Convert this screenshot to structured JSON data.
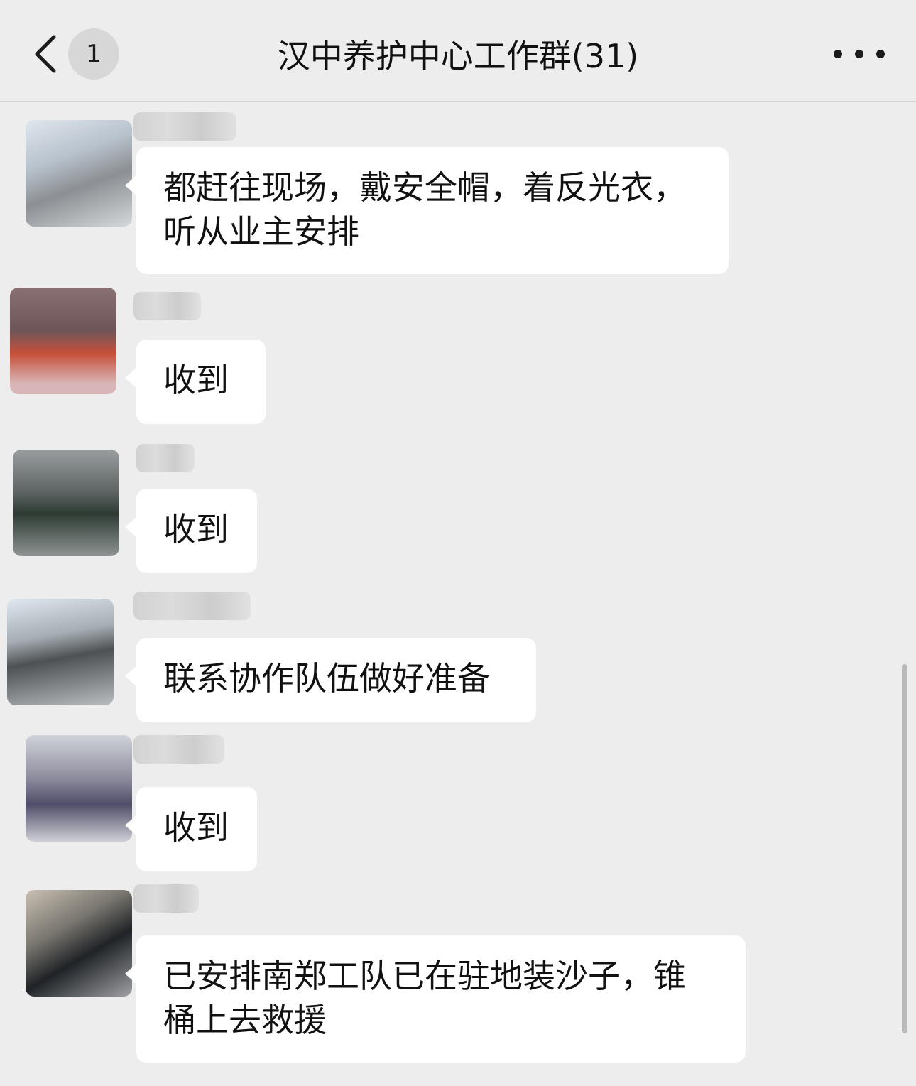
{
  "header": {
    "back_icon": "chevron-left-icon",
    "unread_count": "1",
    "title": "汉中养护中心工作群(31)",
    "more_icon": "more-horizontal-icon"
  },
  "messages": [
    {
      "text_lines": [
        "都赶往现场，戴安全帽，着反光衣，",
        "听从业主安排"
      ]
    },
    {
      "text_lines": [
        "收到"
      ]
    },
    {
      "text_lines": [
        "收到"
      ]
    },
    {
      "text_lines": [
        "联系协作队伍做好准备"
      ]
    },
    {
      "text_lines": [
        "收到"
      ]
    },
    {
      "text_lines": [
        "已安排南郑工队已在驻地装沙子，锥",
        "桶上去救援"
      ]
    }
  ],
  "colors": {
    "background": "#ededed",
    "bubble": "#ffffff",
    "text": "#111111",
    "badge": "#d7d7d7"
  }
}
